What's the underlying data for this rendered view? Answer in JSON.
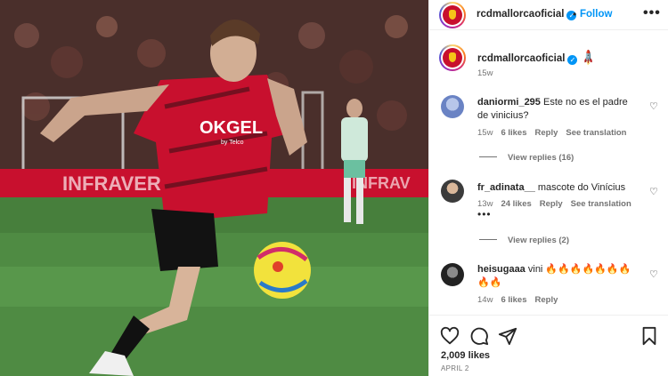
{
  "header": {
    "username": "rcdmallorcaoficial",
    "dot": "•",
    "follow_label": "Follow",
    "more": "•••"
  },
  "caption": {
    "username": "rcdmallorcaoficial",
    "emoji": "🚀",
    "time": "15w"
  },
  "photo": {
    "sponsor_text": "OKGEL",
    "sponsor_sub": "by Telco",
    "board_left": "INFRAVERTE",
    "board_right": "INFRAV"
  },
  "comments": [
    {
      "username": "daniormi_295",
      "text": "Este no es el padre de vinicius?",
      "time": "15w",
      "likes": "6 likes",
      "reply": "Reply",
      "translate": "See translation",
      "view_replies": "View replies (16)"
    },
    {
      "username": "fr_adinata__",
      "text": "mascote do Vinícius",
      "time": "13w",
      "likes": "24 likes",
      "reply": "Reply",
      "translate": "See translation",
      "more": "•••",
      "view_replies": "View replies (2)"
    },
    {
      "username": "heisugaaa",
      "text": "vini 🔥🔥🔥🔥🔥🔥🔥🔥🔥",
      "time": "14w",
      "likes": "6 likes",
      "reply": "Reply"
    }
  ],
  "footer": {
    "likes": "2,009 likes",
    "date": "APRIL 2"
  },
  "colors": {
    "accent": "#0095f6",
    "muted": "#737373",
    "club_red": "#c8102e"
  },
  "icons": [
    "verified-icon",
    "rocket-icon",
    "heart-icon",
    "comment-icon",
    "share-icon",
    "bookmark-icon",
    "more-icon"
  ]
}
